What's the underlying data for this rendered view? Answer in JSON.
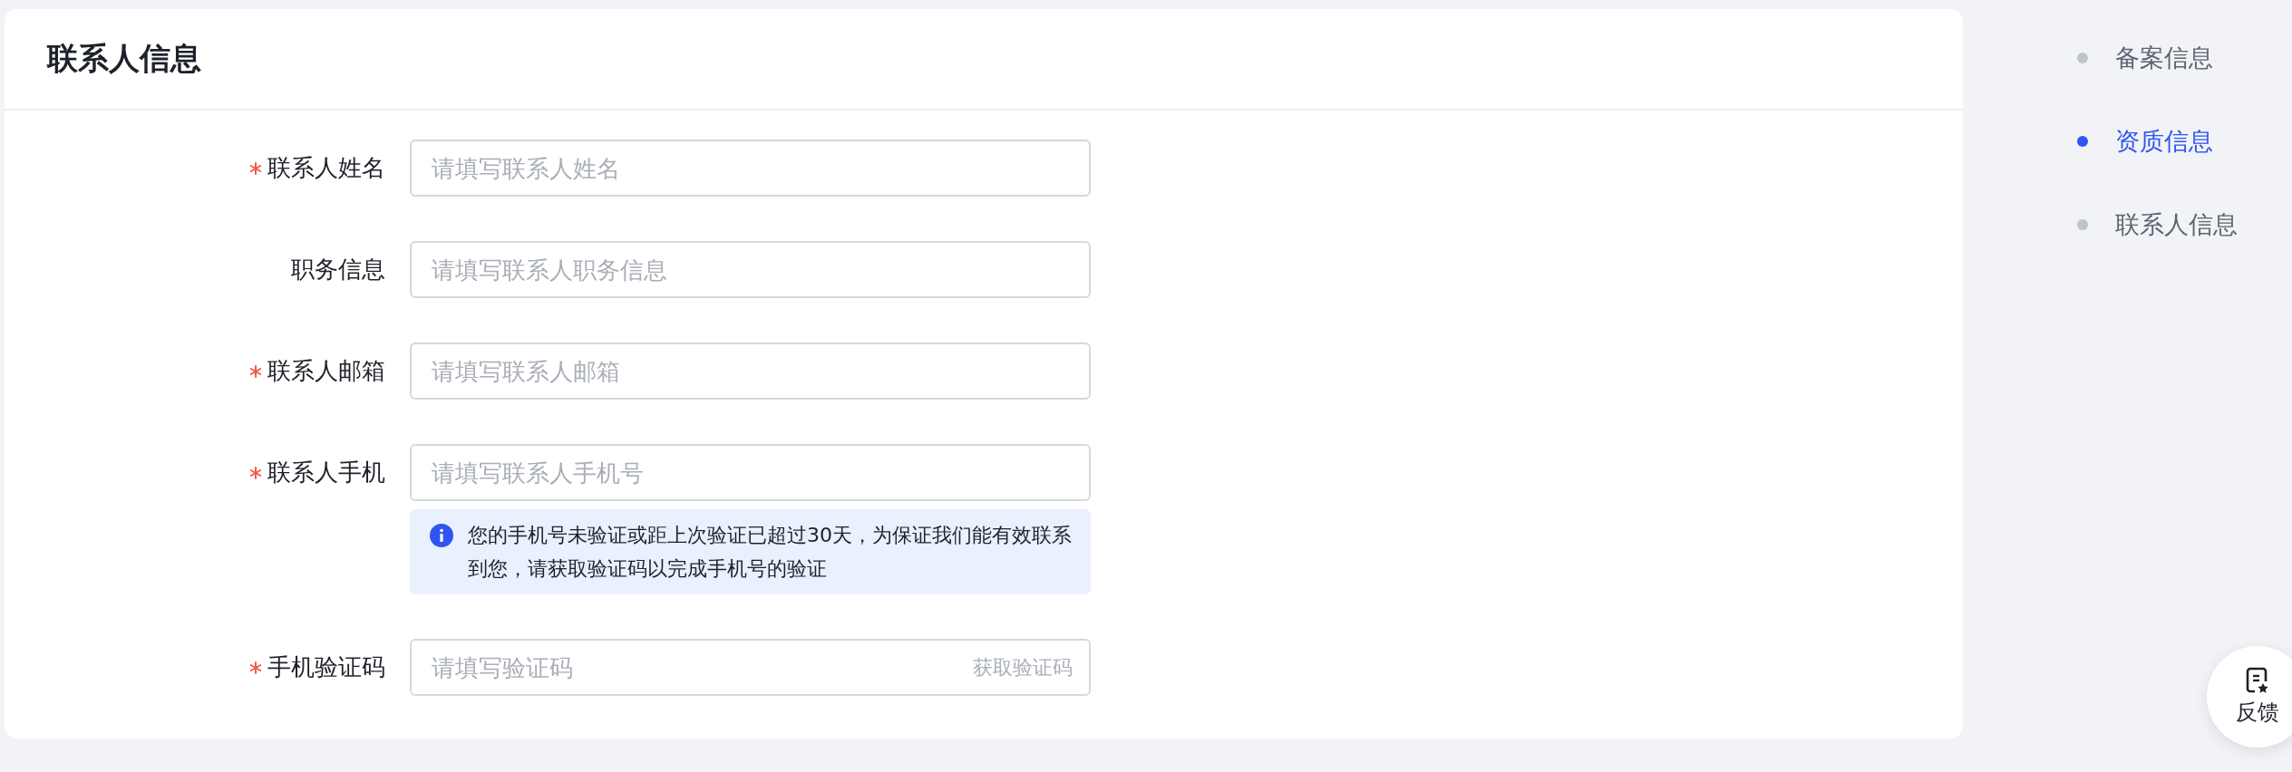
{
  "section": {
    "title": "联系人信息"
  },
  "fields": [
    {
      "kind": "input",
      "label": "联系人姓名",
      "required": true,
      "placeholder": "请填写联系人姓名"
    },
    {
      "kind": "input",
      "label": "职务信息",
      "required": false,
      "placeholder": "请填写联系人职务信息"
    },
    {
      "kind": "input",
      "label": "联系人邮箱",
      "required": true,
      "placeholder": "请填写联系人邮箱"
    },
    {
      "kind": "input",
      "label": "联系人手机",
      "required": true,
      "placeholder": "请填写联系人手机号",
      "note": "您的手机号未验证或距上次验证已超过30天，为保证我们能有效联系到您，请获取验证码以完成手机号的验证"
    },
    {
      "kind": "code",
      "label": "手机验证码",
      "required": true,
      "placeholder": "请填写验证码",
      "action": "获取验证码"
    }
  ],
  "anchor_nav": [
    {
      "label": "备案信息",
      "selected": false
    },
    {
      "label": "资质信息",
      "selected": true
    },
    {
      "label": "联系人信息",
      "selected": false
    }
  ],
  "feedback_button": {
    "label": "反馈"
  }
}
